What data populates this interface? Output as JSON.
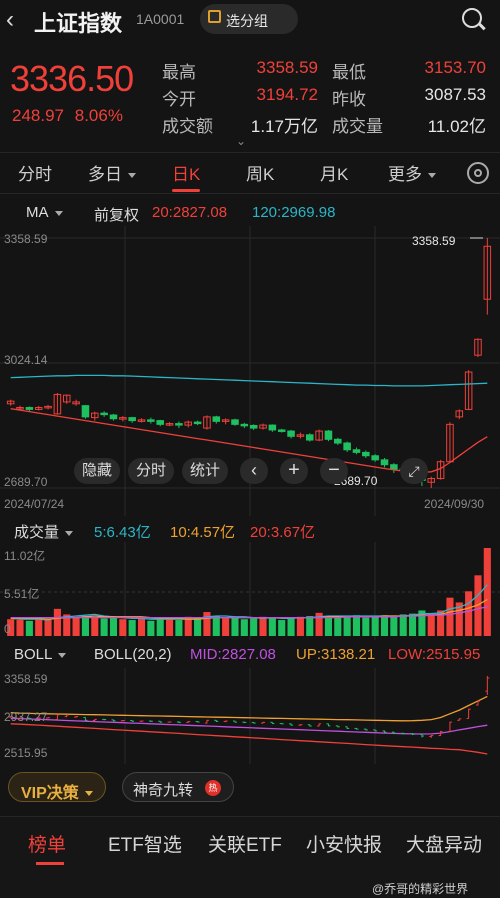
{
  "header": {
    "back_glyph": "‹",
    "title": "上证指数",
    "code": "1A0001",
    "group_label": "选分组"
  },
  "quote": {
    "price": "3336.50",
    "change": "248.97",
    "change_pct": "8.06%",
    "stats": [
      {
        "label": "最高",
        "value": "3358.59",
        "color": "#f0403a"
      },
      {
        "label": "最低",
        "value": "3153.70",
        "color": "#f0403a"
      },
      {
        "label": "今开",
        "value": "3194.72",
        "color": "#f0403a"
      },
      {
        "label": "昨收",
        "value": "3087.53",
        "color": "#e6e6e6"
      },
      {
        "label": "成交额",
        "value": "1.17万亿",
        "color": "#e6e6e6"
      },
      {
        "label": "成交量",
        "value": "11.02亿",
        "color": "#e6e6e6"
      }
    ],
    "expand_glyph": "⌄"
  },
  "tabs": [
    "分时",
    "多日",
    "日K",
    "周K",
    "月K",
    "更多"
  ],
  "active_tab": "日K",
  "ma": {
    "label": "MA",
    "adj": "前复权",
    "ma20": "20:2827.08",
    "ma120": "120:2969.98",
    "ma20_color": "#f0403a",
    "ma120_color": "#2bb6c8"
  },
  "kline": {
    "y_high": "3358.59",
    "y_mid": "3024.14",
    "y_low": "2689.70",
    "high_marker": "3358.59",
    "low_marker": "2689.70",
    "date_start": "2024/07/24",
    "date_end": "2024/09/30"
  },
  "chart_buttons": [
    "隐藏",
    "分时",
    "统计"
  ],
  "volume": {
    "label": "成交量",
    "ma5": "5:6.43亿",
    "ma10": "10:4.57亿",
    "ma20": "20:3.67亿",
    "y_top": "11.02亿",
    "y_mid": "5.51亿",
    "y_bottom": "0"
  },
  "boll": {
    "label": "BOLL",
    "params": "BOLL(20,2)",
    "mid": "MID:2827.08",
    "up": "UP:3138.21",
    "low": "LOW:2515.95",
    "y_top": "3358.59",
    "y_mid": "2937.27",
    "y_bottom": "2515.95"
  },
  "tools": {
    "vip": "VIP决策",
    "shenqi": "神奇九转",
    "hot_badge": "热"
  },
  "bottom_tabs": [
    "榜单",
    "ETF智选",
    "关联ETF",
    "小安快报",
    "大盘异动"
  ],
  "watermark": "@乔哥的精彩世界",
  "chart_data": {
    "type": "candlestick",
    "x_start": "2024/07/24",
    "x_end": "2024/09/30",
    "ylim": [
      2689.7,
      3358.59
    ],
    "candles": [
      {
        "o": 2915,
        "c": 2922,
        "h": 2926,
        "l": 2910
      },
      {
        "o": 2902,
        "c": 2905,
        "h": 2910,
        "l": 2898
      },
      {
        "o": 2905,
        "c": 2900,
        "h": 2908,
        "l": 2895
      },
      {
        "o": 2900,
        "c": 2905,
        "h": 2909,
        "l": 2897
      },
      {
        "o": 2905,
        "c": 2908,
        "h": 2912,
        "l": 2900
      },
      {
        "o": 2888,
        "c": 2940,
        "h": 2944,
        "l": 2886
      },
      {
        "o": 2920,
        "c": 2938,
        "h": 2940,
        "l": 2915
      },
      {
        "o": 2915,
        "c": 2920,
        "h": 2926,
        "l": 2910
      },
      {
        "o": 2910,
        "c": 2880,
        "h": 2912,
        "l": 2875
      },
      {
        "o": 2878,
        "c": 2890,
        "h": 2894,
        "l": 2870
      },
      {
        "o": 2890,
        "c": 2888,
        "h": 2895,
        "l": 2880
      },
      {
        "o": 2885,
        "c": 2875,
        "h": 2888,
        "l": 2870
      },
      {
        "o": 2875,
        "c": 2878,
        "h": 2882,
        "l": 2868
      },
      {
        "o": 2878,
        "c": 2870,
        "h": 2880,
        "l": 2864
      },
      {
        "o": 2870,
        "c": 2872,
        "h": 2876,
        "l": 2865
      },
      {
        "o": 2872,
        "c": 2870,
        "h": 2878,
        "l": 2862
      },
      {
        "o": 2870,
        "c": 2860,
        "h": 2872,
        "l": 2855
      },
      {
        "o": 2860,
        "c": 2862,
        "h": 2866,
        "l": 2855
      },
      {
        "o": 2862,
        "c": 2858,
        "h": 2868,
        "l": 2850
      },
      {
        "o": 2858,
        "c": 2866,
        "h": 2870,
        "l": 2852
      },
      {
        "o": 2866,
        "c": 2862,
        "h": 2870,
        "l": 2858
      },
      {
        "o": 2850,
        "c": 2880,
        "h": 2884,
        "l": 2846
      },
      {
        "o": 2880,
        "c": 2868,
        "h": 2883,
        "l": 2862
      },
      {
        "o": 2868,
        "c": 2872,
        "h": 2876,
        "l": 2860
      },
      {
        "o": 2872,
        "c": 2860,
        "h": 2875,
        "l": 2856
      },
      {
        "o": 2860,
        "c": 2857,
        "h": 2864,
        "l": 2850
      },
      {
        "o": 2857,
        "c": 2850,
        "h": 2860,
        "l": 2845
      },
      {
        "o": 2850,
        "c": 2858,
        "h": 2862,
        "l": 2846
      },
      {
        "o": 2858,
        "c": 2845,
        "h": 2860,
        "l": 2840
      },
      {
        "o": 2845,
        "c": 2842,
        "h": 2848,
        "l": 2838
      },
      {
        "o": 2842,
        "c": 2828,
        "h": 2845,
        "l": 2822
      },
      {
        "o": 2828,
        "c": 2832,
        "h": 2838,
        "l": 2822
      },
      {
        "o": 2832,
        "c": 2818,
        "h": 2836,
        "l": 2814
      },
      {
        "o": 2818,
        "c": 2842,
        "h": 2846,
        "l": 2815
      },
      {
        "o": 2842,
        "c": 2820,
        "h": 2845,
        "l": 2815
      },
      {
        "o": 2820,
        "c": 2810,
        "h": 2824,
        "l": 2805
      },
      {
        "o": 2810,
        "c": 2792,
        "h": 2814,
        "l": 2786
      },
      {
        "o": 2792,
        "c": 2785,
        "h": 2798,
        "l": 2780
      },
      {
        "o": 2785,
        "c": 2776,
        "h": 2790,
        "l": 2770
      },
      {
        "o": 2776,
        "c": 2765,
        "h": 2780,
        "l": 2760
      },
      {
        "o": 2765,
        "c": 2752,
        "h": 2770,
        "l": 2745
      },
      {
        "o": 2752,
        "c": 2740,
        "h": 2756,
        "l": 2730
      },
      {
        "o": 2740,
        "c": 2737,
        "h": 2746,
        "l": 2728
      },
      {
        "o": 2737,
        "c": 2728,
        "h": 2742,
        "l": 2720
      },
      {
        "o": 2728,
        "c": 2710,
        "h": 2732,
        "l": 2695
      },
      {
        "o": 2705,
        "c": 2715,
        "h": 2720,
        "l": 2689.7
      },
      {
        "o": 2715,
        "c": 2760,
        "h": 2765,
        "l": 2712
      },
      {
        "o": 2760,
        "c": 2860,
        "h": 2866,
        "l": 2758
      },
      {
        "o": 2880,
        "c": 2896,
        "h": 2900,
        "l": 2874
      },
      {
        "o": 2900,
        "c": 3000,
        "h": 3005,
        "l": 2898
      },
      {
        "o": 3045,
        "c": 3087.53,
        "h": 3090,
        "l": 3040
      },
      {
        "o": 3194.72,
        "c": 3336.5,
        "h": 3358.59,
        "l": 3153.7
      }
    ],
    "ma20": [
      2902,
      2898,
      2894,
      2890,
      2886,
      2882,
      2878,
      2874,
      2870,
      2866,
      2862,
      2858,
      2854,
      2850,
      2846,
      2842,
      2838,
      2834,
      2830,
      2826,
      2822,
      2818,
      2814,
      2810,
      2806,
      2802,
      2798,
      2794,
      2790,
      2786,
      2782,
      2778,
      2774,
      2770,
      2766,
      2762,
      2758,
      2754,
      2750,
      2746,
      2742,
      2738,
      2735,
      2733,
      2732,
      2733,
      2742,
      2758,
      2776,
      2794,
      2812,
      2827.08
    ],
    "ma120": [
      2985,
      2986,
      2987,
      2988,
      2989,
      2990,
      2990,
      2991,
      2991,
      2991,
      2991,
      2990,
      2990,
      2989,
      2988,
      2987,
      2986,
      2985,
      2984,
      2983,
      2982,
      2981,
      2980,
      2979,
      2978,
      2977,
      2976,
      2975,
      2974,
      2973,
      2972,
      2971,
      2970,
      2969,
      2968,
      2967,
      2966,
      2965,
      2965,
      2964,
      2964,
      2963,
      2963,
      2963,
      2963,
      2964,
      2965,
      2966,
      2967,
      2968,
      2969,
      2969.98
    ],
    "volume": [
      2.1,
      2.0,
      1.9,
      2.2,
      2.0,
      3.4,
      2.7,
      2.4,
      2.5,
      2.3,
      2.2,
      2.4,
      2.1,
      2.0,
      2.2,
      1.9,
      2.3,
      2.1,
      2.0,
      2.4,
      2.1,
      3.0,
      2.5,
      2.2,
      2.3,
      2.1,
      2.2,
      2.4,
      2.3,
      2.0,
      2.2,
      2.4,
      2.5,
      2.9,
      2.3,
      2.4,
      2.5,
      2.6,
      2.3,
      2.4,
      2.6,
      2.5,
      2.7,
      2.8,
      3.2,
      2.8,
      3.2,
      4.8,
      4.2,
      5.6,
      7.6,
      11.02
    ],
    "volume_ma5": [
      2.2,
      2.1,
      2.1,
      2.1,
      2.0,
      2.3,
      2.4,
      2.5,
      2.6,
      2.7,
      2.5,
      2.4,
      2.3,
      2.2,
      2.2,
      2.1,
      2.1,
      2.1,
      2.1,
      2.1,
      2.2,
      2.4,
      2.5,
      2.5,
      2.4,
      2.4,
      2.3,
      2.2,
      2.3,
      2.2,
      2.2,
      2.3,
      2.3,
      2.4,
      2.5,
      2.5,
      2.5,
      2.5,
      2.5,
      2.5,
      2.5,
      2.5,
      2.5,
      2.6,
      2.8,
      2.8,
      2.9,
      3.4,
      3.6,
      4.1,
      5.1,
      6.43
    ],
    "volume_ma10": [
      2.2,
      2.2,
      2.2,
      2.2,
      2.1,
      2.2,
      2.3,
      2.3,
      2.4,
      2.5,
      2.4,
      2.4,
      2.4,
      2.4,
      2.4,
      2.3,
      2.2,
      2.2,
      2.2,
      2.1,
      2.1,
      2.2,
      2.3,
      2.3,
      2.3,
      2.3,
      2.3,
      2.3,
      2.3,
      2.3,
      2.3,
      2.3,
      2.3,
      2.3,
      2.4,
      2.4,
      2.4,
      2.4,
      2.4,
      2.4,
      2.5,
      2.5,
      2.5,
      2.5,
      2.6,
      2.6,
      2.7,
      3.0,
      3.2,
      3.5,
      3.9,
      4.57
    ],
    "volume_ma20": [
      2.3,
      2.3,
      2.3,
      2.3,
      2.3,
      2.3,
      2.3,
      2.3,
      2.3,
      2.3,
      2.3,
      2.3,
      2.3,
      2.3,
      2.3,
      2.3,
      2.3,
      2.3,
      2.3,
      2.3,
      2.3,
      2.3,
      2.3,
      2.3,
      2.3,
      2.3,
      2.3,
      2.3,
      2.3,
      2.3,
      2.3,
      2.3,
      2.3,
      2.3,
      2.3,
      2.3,
      2.4,
      2.4,
      2.4,
      2.4,
      2.4,
      2.4,
      2.5,
      2.5,
      2.5,
      2.6,
      2.6,
      2.7,
      2.9,
      3.1,
      3.4,
      3.67
    ],
    "boll_mid": [
      2902,
      2898,
      2894,
      2890,
      2886,
      2882,
      2878,
      2874,
      2870,
      2866,
      2862,
      2858,
      2854,
      2850,
      2846,
      2842,
      2838,
      2834,
      2830,
      2826,
      2822,
      2818,
      2814,
      2810,
      2806,
      2802,
      2798,
      2794,
      2790,
      2786,
      2782,
      2778,
      2774,
      2770,
      2766,
      2762,
      2758,
      2754,
      2750,
      2746,
      2742,
      2738,
      2735,
      2733,
      2732,
      2733,
      2742,
      2758,
      2776,
      2794,
      2812,
      2827.08
    ],
    "boll_up": [
      2962,
      2958,
      2955,
      2952,
      2950,
      2948,
      2946,
      2944,
      2942,
      2940,
      2938,
      2936,
      2934,
      2932,
      2930,
      2928,
      2926,
      2924,
      2922,
      2920,
      2918,
      2916,
      2914,
      2912,
      2910,
      2908,
      2906,
      2904,
      2902,
      2900,
      2898,
      2896,
      2894,
      2892,
      2890,
      2888,
      2886,
      2884,
      2882,
      2880,
      2878,
      2876,
      2875,
      2876,
      2880,
      2888,
      2910,
      2950,
      2990,
      3040,
      3090,
      3138.21
    ],
    "boll_low": [
      2842,
      2838,
      2833,
      2828,
      2822,
      2816,
      2810,
      2804,
      2798,
      2792,
      2786,
      2780,
      2774,
      2768,
      2762,
      2756,
      2750,
      2744,
      2738,
      2732,
      2726,
      2720,
      2714,
      2708,
      2702,
      2696,
      2690,
      2684,
      2678,
      2672,
      2666,
      2660,
      2654,
      2648,
      2642,
      2636,
      2630,
      2624,
      2618,
      2612,
      2606,
      2600,
      2595,
      2590,
      2584,
      2578,
      2574,
      2566,
      2562,
      2548,
      2534,
      2515.95
    ],
    "boll_ylim": [
      2515.95,
      3358.59
    ]
  }
}
